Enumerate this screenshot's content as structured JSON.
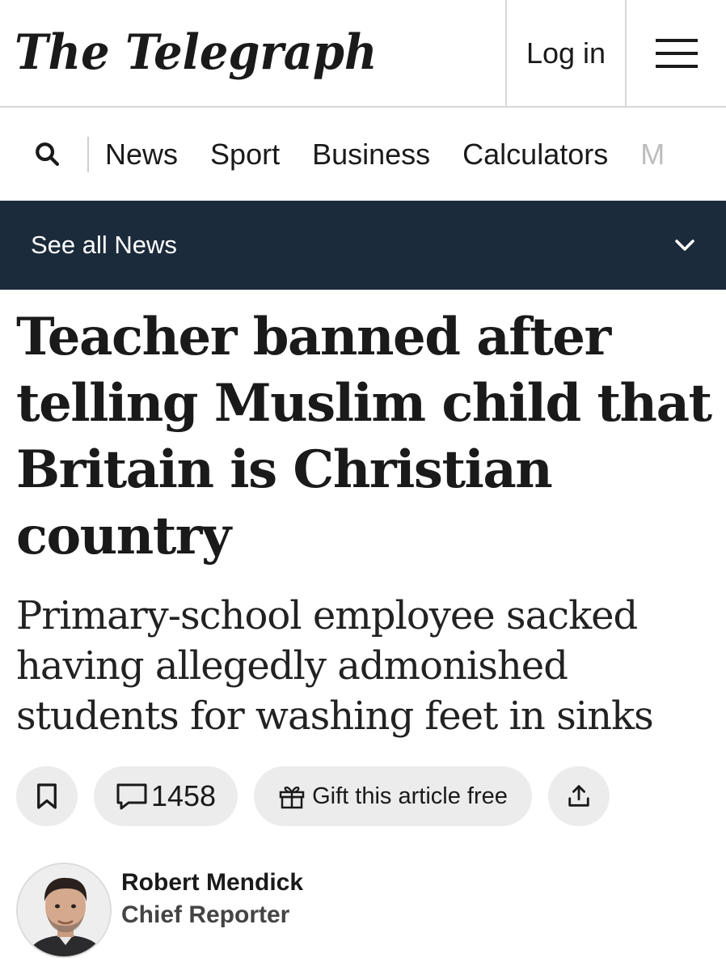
{
  "header": {
    "logo": "The Telegraph",
    "login_label": "Log in",
    "menu_icon": "hamburger-menu-icon"
  },
  "nav": {
    "search_icon": "search-icon",
    "items": [
      "News",
      "Sport",
      "Business",
      "Calculators",
      "M"
    ]
  },
  "section_bar": {
    "label": "See all News",
    "icon": "chevron-down-icon",
    "background": "#1c2b3b"
  },
  "article": {
    "headline": "Teacher banned after telling Muslim child that Britain is Christian country",
    "standfirst": "Primary-school employee sacked having allegedly admonished students for washing feet in sinks"
  },
  "actions": {
    "bookmark_icon": "bookmark-icon",
    "comment_count": "1458",
    "gift_label": "Gift this article free",
    "share_icon": "share-icon"
  },
  "byline": {
    "name": "Robert Mendick",
    "role": "Chief Reporter"
  }
}
